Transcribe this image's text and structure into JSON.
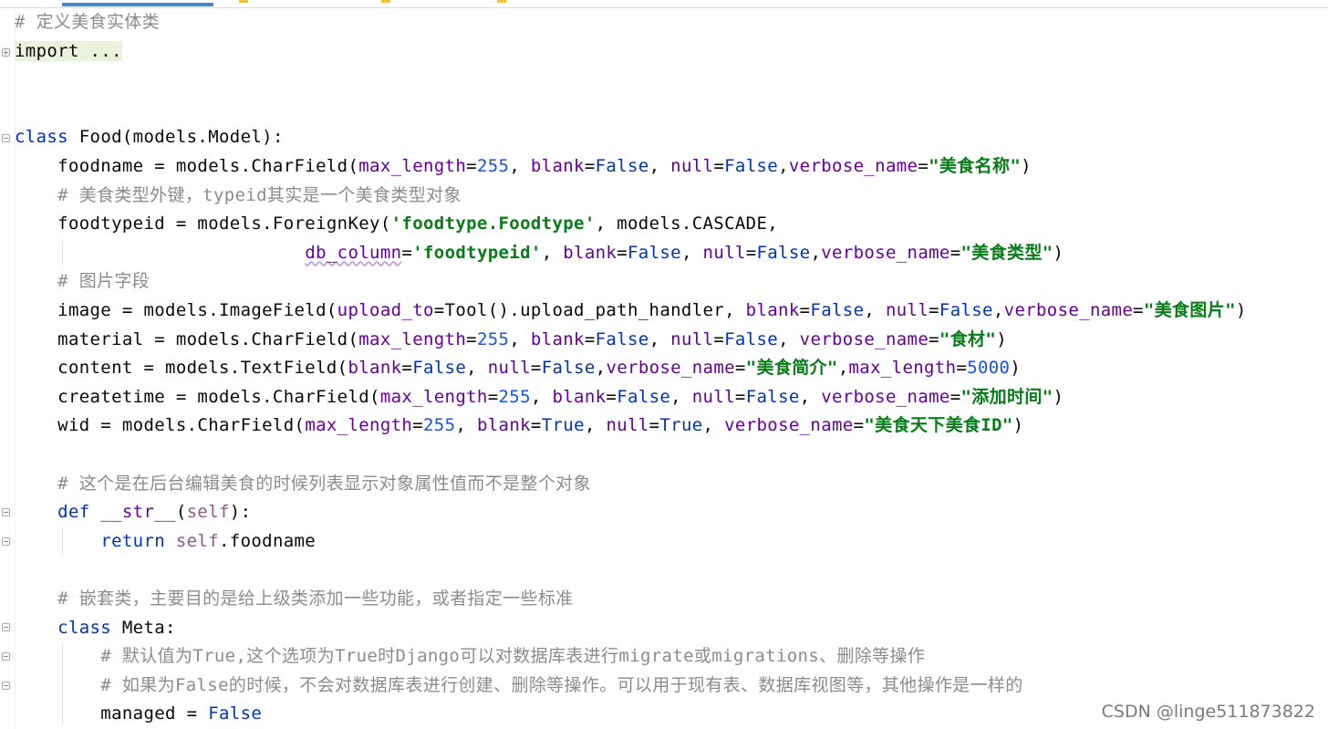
{
  "editor": {
    "lines": [
      {
        "segments": [
          {
            "t": "# 定义美食实体类",
            "c": "comment"
          }
        ]
      },
      {
        "segments": [
          {
            "t": "import ...",
            "c": "import-bg"
          }
        ]
      },
      {
        "segments": []
      },
      {
        "segments": []
      },
      {
        "segments": [
          {
            "t": "class",
            "c": "kw"
          },
          {
            "t": " Food(models.Model):",
            "c": ""
          }
        ]
      },
      {
        "segments": [
          {
            "t": "    foodname = models.CharField(",
            "c": ""
          },
          {
            "t": "max_length",
            "c": "param"
          },
          {
            "t": "=",
            "c": ""
          },
          {
            "t": "255",
            "c": "num"
          },
          {
            "t": ", ",
            "c": ""
          },
          {
            "t": "blank",
            "c": "param"
          },
          {
            "t": "=",
            "c": ""
          },
          {
            "t": "False",
            "c": "kw"
          },
          {
            "t": ", ",
            "c": ""
          },
          {
            "t": "null",
            "c": "param"
          },
          {
            "t": "=",
            "c": ""
          },
          {
            "t": "False",
            "c": "kw"
          },
          {
            "t": ",",
            "c": ""
          },
          {
            "t": "verbose_name",
            "c": "param"
          },
          {
            "t": "=",
            "c": ""
          },
          {
            "t": "\"美食名称\"",
            "c": "str"
          },
          {
            "t": ")",
            "c": ""
          }
        ]
      },
      {
        "segments": [
          {
            "t": "    # 美食类型外键，typeid其实是一个美食类型对象",
            "c": "comment"
          }
        ]
      },
      {
        "segments": [
          {
            "t": "    foodtypeid = models.ForeignKey(",
            "c": ""
          },
          {
            "t": "'foodtype.Foodtype'",
            "c": "str"
          },
          {
            "t": ", models.CASCADE,",
            "c": ""
          }
        ]
      },
      {
        "segments": [
          {
            "t": "                           ",
            "c": ""
          },
          {
            "t": "db_column",
            "c": "param typo"
          },
          {
            "t": "=",
            "c": ""
          },
          {
            "t": "'foodtypeid'",
            "c": "str"
          },
          {
            "t": ", ",
            "c": ""
          },
          {
            "t": "blank",
            "c": "param"
          },
          {
            "t": "=",
            "c": ""
          },
          {
            "t": "False",
            "c": "kw"
          },
          {
            "t": ", ",
            "c": ""
          },
          {
            "t": "null",
            "c": "param"
          },
          {
            "t": "=",
            "c": ""
          },
          {
            "t": "False",
            "c": "kw"
          },
          {
            "t": ",",
            "c": ""
          },
          {
            "t": "verbose_name",
            "c": "param"
          },
          {
            "t": "=",
            "c": ""
          },
          {
            "t": "\"美食类型\"",
            "c": "str"
          },
          {
            "t": ")",
            "c": ""
          }
        ]
      },
      {
        "segments": [
          {
            "t": "    # 图片字段",
            "c": "comment"
          }
        ]
      },
      {
        "segments": [
          {
            "t": "    image = models.ImageField(",
            "c": ""
          },
          {
            "t": "upload_to",
            "c": "param"
          },
          {
            "t": "=Tool().upload_path_handler, ",
            "c": ""
          },
          {
            "t": "blank",
            "c": "param"
          },
          {
            "t": "=",
            "c": ""
          },
          {
            "t": "False",
            "c": "kw"
          },
          {
            "t": ", ",
            "c": ""
          },
          {
            "t": "null",
            "c": "param"
          },
          {
            "t": "=",
            "c": ""
          },
          {
            "t": "False",
            "c": "kw"
          },
          {
            "t": ",",
            "c": ""
          },
          {
            "t": "verbose_name",
            "c": "param"
          },
          {
            "t": "=",
            "c": ""
          },
          {
            "t": "\"美食图片\"",
            "c": "str"
          },
          {
            "t": ")",
            "c": ""
          }
        ]
      },
      {
        "segments": [
          {
            "t": "    material = models.CharField(",
            "c": ""
          },
          {
            "t": "max_length",
            "c": "param"
          },
          {
            "t": "=",
            "c": ""
          },
          {
            "t": "255",
            "c": "num"
          },
          {
            "t": ", ",
            "c": ""
          },
          {
            "t": "blank",
            "c": "param"
          },
          {
            "t": "=",
            "c": ""
          },
          {
            "t": "False",
            "c": "kw"
          },
          {
            "t": ", ",
            "c": ""
          },
          {
            "t": "null",
            "c": "param"
          },
          {
            "t": "=",
            "c": ""
          },
          {
            "t": "False",
            "c": "kw"
          },
          {
            "t": ", ",
            "c": ""
          },
          {
            "t": "verbose_name",
            "c": "param"
          },
          {
            "t": "=",
            "c": ""
          },
          {
            "t": "\"食材\"",
            "c": "str"
          },
          {
            "t": ")",
            "c": ""
          }
        ]
      },
      {
        "segments": [
          {
            "t": "    content = models.TextField(",
            "c": ""
          },
          {
            "t": "blank",
            "c": "param"
          },
          {
            "t": "=",
            "c": ""
          },
          {
            "t": "False",
            "c": "kw"
          },
          {
            "t": ", ",
            "c": ""
          },
          {
            "t": "null",
            "c": "param"
          },
          {
            "t": "=",
            "c": ""
          },
          {
            "t": "False",
            "c": "kw"
          },
          {
            "t": ",",
            "c": ""
          },
          {
            "t": "verbose_name",
            "c": "param"
          },
          {
            "t": "=",
            "c": ""
          },
          {
            "t": "\"美食简介\"",
            "c": "str"
          },
          {
            "t": ",",
            "c": ""
          },
          {
            "t": "max_length",
            "c": "param"
          },
          {
            "t": "=",
            "c": ""
          },
          {
            "t": "5000",
            "c": "num"
          },
          {
            "t": ")",
            "c": ""
          }
        ]
      },
      {
        "segments": [
          {
            "t": "    createtime = models.CharField(",
            "c": ""
          },
          {
            "t": "max_length",
            "c": "param"
          },
          {
            "t": "=",
            "c": ""
          },
          {
            "t": "255",
            "c": "num"
          },
          {
            "t": ", ",
            "c": ""
          },
          {
            "t": "blank",
            "c": "param"
          },
          {
            "t": "=",
            "c": ""
          },
          {
            "t": "False",
            "c": "kw"
          },
          {
            "t": ", ",
            "c": ""
          },
          {
            "t": "null",
            "c": "param"
          },
          {
            "t": "=",
            "c": ""
          },
          {
            "t": "False",
            "c": "kw"
          },
          {
            "t": ", ",
            "c": ""
          },
          {
            "t": "verbose_name",
            "c": "param"
          },
          {
            "t": "=",
            "c": ""
          },
          {
            "t": "\"添加时间\"",
            "c": "str"
          },
          {
            "t": ")",
            "c": ""
          }
        ]
      },
      {
        "segments": [
          {
            "t": "    wid = models.CharField(",
            "c": ""
          },
          {
            "t": "max_length",
            "c": "param"
          },
          {
            "t": "=",
            "c": ""
          },
          {
            "t": "255",
            "c": "num"
          },
          {
            "t": ", ",
            "c": ""
          },
          {
            "t": "blank",
            "c": "param"
          },
          {
            "t": "=",
            "c": ""
          },
          {
            "t": "True",
            "c": "kw"
          },
          {
            "t": ", ",
            "c": ""
          },
          {
            "t": "null",
            "c": "param"
          },
          {
            "t": "=",
            "c": ""
          },
          {
            "t": "True",
            "c": "kw"
          },
          {
            "t": ", ",
            "c": ""
          },
          {
            "t": "verbose_name",
            "c": "param"
          },
          {
            "t": "=",
            "c": ""
          },
          {
            "t": "\"美食天下美食ID\"",
            "c": "str"
          },
          {
            "t": ")",
            "c": ""
          }
        ]
      },
      {
        "segments": []
      },
      {
        "segments": [
          {
            "t": "    # 这个是在后台编辑美食的时候列表显示对象属性值而不是整个对象",
            "c": "comment"
          }
        ]
      },
      {
        "segments": [
          {
            "t": "    ",
            "c": ""
          },
          {
            "t": "def",
            "c": "kw"
          },
          {
            "t": " __str__",
            "c": "param"
          },
          {
            "t": "(",
            "c": ""
          },
          {
            "t": "self",
            "c": "self"
          },
          {
            "t": "):",
            "c": ""
          }
        ]
      },
      {
        "segments": [
          {
            "t": "        ",
            "c": ""
          },
          {
            "t": "return",
            "c": "kw"
          },
          {
            "t": " ",
            "c": ""
          },
          {
            "t": "self",
            "c": "self"
          },
          {
            "t": ".foodname",
            "c": ""
          }
        ]
      },
      {
        "segments": []
      },
      {
        "segments": [
          {
            "t": "    # 嵌套类，主要目的是给上级类添加一些功能，或者指定一些标准",
            "c": "comment"
          }
        ]
      },
      {
        "segments": [
          {
            "t": "    ",
            "c": ""
          },
          {
            "t": "class",
            "c": "kw"
          },
          {
            "t": " Meta:",
            "c": ""
          }
        ]
      },
      {
        "segments": [
          {
            "t": "        # 默认值为True,这个选项为True时Django可以对数据库表进行migrate或migrations、删除等操作",
            "c": "comment"
          }
        ]
      },
      {
        "segments": [
          {
            "t": "        # 如果为False的时候，不会对数据库表进行创建、删除等操作。可以用于现有表、数据库视图等，其他操作是一样的",
            "c": "comment"
          }
        ]
      },
      {
        "segments": [
          {
            "t": "        managed = ",
            "c": ""
          },
          {
            "t": "False",
            "c": "kw"
          }
        ]
      }
    ]
  },
  "watermark": "CSDN @linge511873822"
}
